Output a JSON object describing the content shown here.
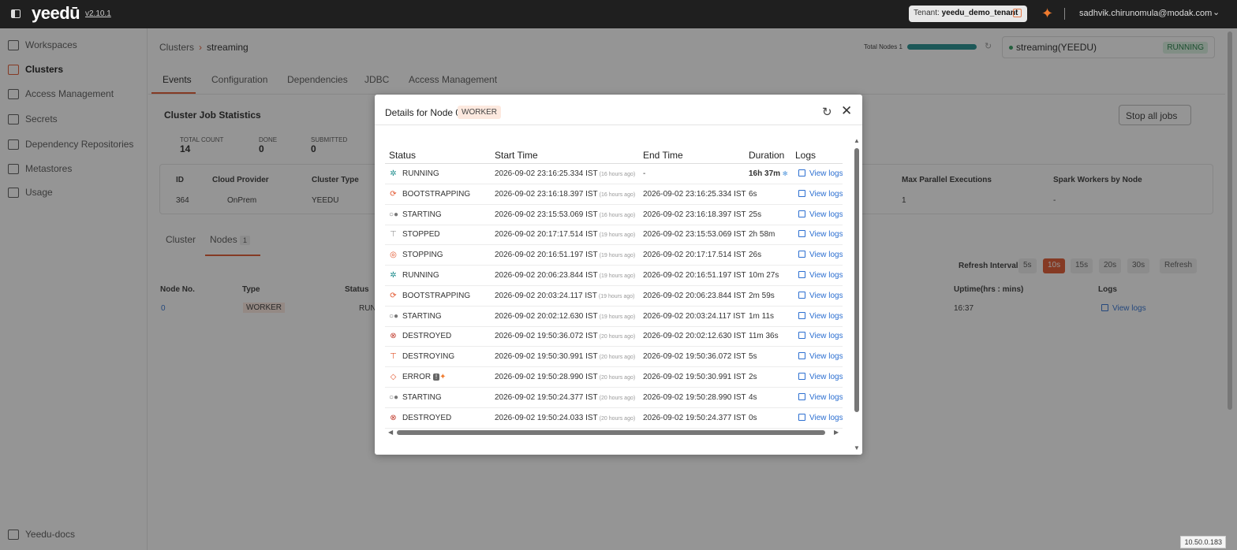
{
  "topbar": {
    "logo": "yeedū",
    "version": "v2.10.1",
    "tenant_label": "Tenant:",
    "tenant_name": "yeedu_demo_tenant",
    "user_email": "sadhvik.chirunomula@modak.com"
  },
  "sidebar": {
    "items": [
      {
        "label": "Workspaces",
        "icon": "workspace-icon"
      },
      {
        "label": "Clusters",
        "icon": "cluster-icon",
        "active": true
      },
      {
        "label": "Access Management",
        "icon": "access-icon"
      },
      {
        "label": "Secrets",
        "icon": "key-icon"
      },
      {
        "label": "Dependency Repositories",
        "icon": "repository-icon"
      },
      {
        "label": "Metastores",
        "icon": "database-icon"
      },
      {
        "label": "Usage",
        "icon": "usage-icon"
      }
    ],
    "footer": "Yeedu-docs"
  },
  "main": {
    "breadcrumb": {
      "root": "Clusters",
      "current": "streaming"
    },
    "total_nodes_label": "Total Nodes 1",
    "cluster_selector": {
      "name": "streaming(YEEDU)",
      "status": "RUNNING"
    },
    "tabs": [
      "Events",
      "Configuration",
      "Dependencies",
      "JDBC",
      "Access Management"
    ],
    "job_stats_title": "Cluster Job Statistics",
    "stop_all": "Stop all jobs",
    "stats": [
      {
        "label": "TOTAL COUNT",
        "value": "14"
      },
      {
        "label": "DONE",
        "value": "0"
      },
      {
        "label": "SUBMITTED",
        "value": "0"
      }
    ],
    "info_headers": [
      "ID",
      "Cloud Provider",
      "Cluster Type",
      "Max Parallel Executions",
      "Spark Workers by Node"
    ],
    "info_values": [
      "364",
      "OnPrem",
      "YEEDU",
      "1",
      "-"
    ],
    "subtabs": {
      "cluster": "Cluster",
      "nodes": "Nodes",
      "nodes_count": "1"
    },
    "refresh": {
      "label": "Refresh Interval:",
      "options": [
        "5s",
        "10s",
        "15s",
        "20s",
        "30s"
      ],
      "selected": "10s",
      "button": "Refresh"
    },
    "nodes_headers": [
      "Node No.",
      "Type",
      "Status",
      "Uptime(hrs : mins)",
      "Logs"
    ],
    "nodes_row": {
      "no": "0",
      "type": "WORKER",
      "status": "RUN",
      "uptime": "16:37",
      "logs": "View logs"
    }
  },
  "modal": {
    "title": "Details for Node 0",
    "badge": "WORKER",
    "headers": [
      "Status",
      "Start Time",
      "End Time",
      "Duration",
      "Logs"
    ],
    "rows": [
      {
        "status": "RUNNING",
        "icon": "running-icon",
        "start": "2026-09-02 23:16:25.334 IST",
        "ago": "(16 hours ago)",
        "end": "-",
        "duration": "16h 37m",
        "logs": "View logs"
      },
      {
        "status": "BOOTSTRAPPING",
        "icon": "bootstrap-icon",
        "start": "2026-09-02 23:16:18.397 IST",
        "ago": "(16 hours ago)",
        "end": "2026-09-02 23:16:25.334 IST",
        "duration": "6s",
        "logs": "View logs"
      },
      {
        "status": "STARTING",
        "icon": "starting-icon",
        "start": "2026-09-02 23:15:53.069 IST",
        "ago": "(16 hours ago)",
        "end": "2026-09-02 23:16:18.397 IST",
        "duration": "25s",
        "logs": "View logs"
      },
      {
        "status": "STOPPED",
        "icon": "stopped-icon",
        "start": "2026-09-02 20:17:17.514 IST",
        "ago": "(19 hours ago)",
        "end": "2026-09-02 23:15:53.069 IST",
        "duration": "2h 58m",
        "logs": "View logs"
      },
      {
        "status": "STOPPING",
        "icon": "stopping-icon",
        "start": "2026-09-02 20:16:51.197 IST",
        "ago": "(19 hours ago)",
        "end": "2026-09-02 20:17:17.514 IST",
        "duration": "26s",
        "logs": "View logs"
      },
      {
        "status": "RUNNING",
        "icon": "running-icon",
        "start": "2026-09-02 20:06:23.844 IST",
        "ago": "(19 hours ago)",
        "end": "2026-09-02 20:16:51.197 IST",
        "duration": "10m 27s",
        "logs": "View logs"
      },
      {
        "status": "BOOTSTRAPPING",
        "icon": "bootstrap-icon",
        "start": "2026-09-02 20:03:24.117 IST",
        "ago": "(19 hours ago)",
        "end": "2026-09-02 20:06:23.844 IST",
        "duration": "2m 59s",
        "logs": "View logs"
      },
      {
        "status": "STARTING",
        "icon": "starting-icon",
        "start": "2026-09-02 20:02:12.630 IST",
        "ago": "(19 hours ago)",
        "end": "2026-09-02 20:03:24.117 IST",
        "duration": "1m 11s",
        "logs": "View logs"
      },
      {
        "status": "DESTROYED",
        "icon": "destroyed-icon",
        "start": "2026-09-02 19:50:36.072 IST",
        "ago": "(20 hours ago)",
        "end": "2026-09-02 20:02:12.630 IST",
        "duration": "11m 36s",
        "logs": "View logs"
      },
      {
        "status": "DESTROYING",
        "icon": "destroying-icon",
        "start": "2026-09-02 19:50:30.991 IST",
        "ago": "(20 hours ago)",
        "end": "2026-09-02 19:50:36.072 IST",
        "duration": "5s",
        "logs": "View logs"
      },
      {
        "status": "ERROR",
        "icon": "error-icon",
        "start": "2026-09-02 19:50:28.990 IST",
        "ago": "(20 hours ago)",
        "end": "2026-09-02 19:50:30.991 IST",
        "duration": "2s",
        "logs": "View logs"
      },
      {
        "status": "STARTING",
        "icon": "starting-icon",
        "start": "2026-09-02 19:50:24.377 IST",
        "ago": "(20 hours ago)",
        "end": "2026-09-02 19:50:28.990 IST",
        "duration": "4s",
        "logs": "View logs"
      },
      {
        "status": "DESTROYED",
        "icon": "destroyed-icon",
        "start": "2026-09-02 19:50:24.033 IST",
        "ago": "(20 hours ago)",
        "end": "2026-09-02 19:50:24.377 IST",
        "duration": "0s",
        "logs": "View logs"
      }
    ]
  },
  "ip": "10.50.0.183",
  "colors": {
    "accent": "#e1532a",
    "link": "#2c6fd1",
    "running": "#1c7a3f"
  }
}
